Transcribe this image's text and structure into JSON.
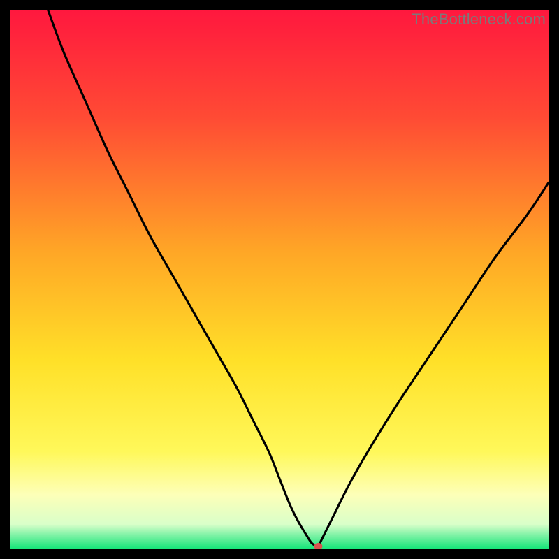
{
  "watermark": "TheBottleneck.com",
  "chart_data": {
    "type": "line",
    "title": "",
    "xlabel": "",
    "ylabel": "",
    "xlim": [
      0,
      100
    ],
    "ylim": [
      0,
      100
    ],
    "gradient_stops": [
      {
        "offset": 0.0,
        "color": "#ff183e"
      },
      {
        "offset": 0.2,
        "color": "#ff4b34"
      },
      {
        "offset": 0.45,
        "color": "#ffa726"
      },
      {
        "offset": 0.65,
        "color": "#ffe028"
      },
      {
        "offset": 0.82,
        "color": "#fff85a"
      },
      {
        "offset": 0.9,
        "color": "#fdffb8"
      },
      {
        "offset": 0.955,
        "color": "#d9ffc9"
      },
      {
        "offset": 0.975,
        "color": "#7ff2a6"
      },
      {
        "offset": 1.0,
        "color": "#18e67a"
      }
    ],
    "series": [
      {
        "name": "bottleneck-curve",
        "color": "#000000",
        "x": [
          7,
          10,
          14,
          18,
          22,
          26,
          30,
          34,
          38,
          42,
          45,
          48,
          50,
          52,
          53.5,
          55,
          56,
          57,
          57,
          57.2,
          58,
          60,
          63,
          67,
          72,
          78,
          84,
          90,
          96,
          100
        ],
        "y": [
          100,
          92,
          83,
          74,
          66,
          58,
          51,
          44,
          37,
          30,
          24,
          18,
          13,
          8,
          5,
          2.5,
          1,
          0.4,
          0.4,
          0.4,
          2,
          6,
          12,
          19,
          27,
          36,
          45,
          54,
          62,
          68
        ]
      }
    ],
    "marker": {
      "x": 57.2,
      "y": 0.4,
      "color": "#d9544f",
      "rx": 6,
      "ry": 5
    }
  }
}
